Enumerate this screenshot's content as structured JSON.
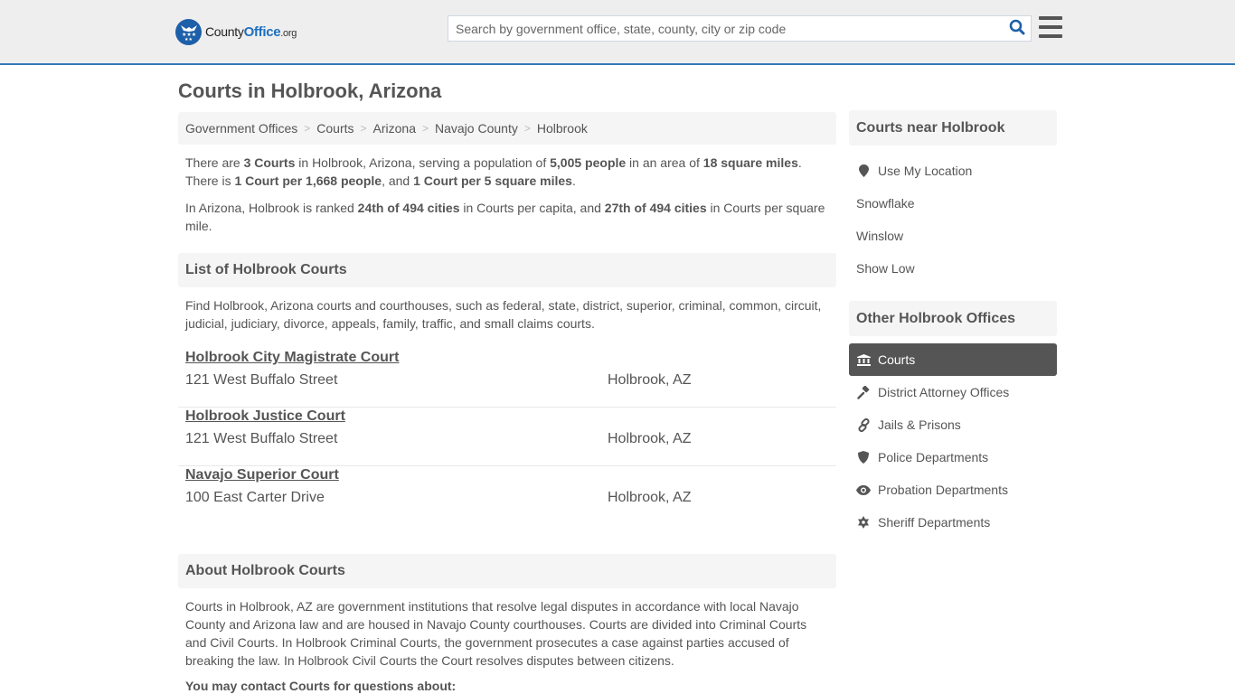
{
  "header": {
    "logo": {
      "brand_main": "County",
      "brand_accent": "Office",
      "brand_tld": ".org"
    },
    "search": {
      "placeholder": "Search by government office, state, county, city or zip code",
      "value": ""
    },
    "colors": {
      "accent": "#337ab7",
      "logo_blue": "#1d5fa8",
      "search_icon": "#1d5fa8"
    }
  },
  "page_title": "Courts in Holbrook, Arizona",
  "breadcrumb": [
    {
      "label": "Government Offices"
    },
    {
      "label": "Courts"
    },
    {
      "label": "Arizona"
    },
    {
      "label": "Navajo County"
    },
    {
      "label": "Holbrook"
    }
  ],
  "summary": {
    "line1_a": "There are ",
    "count": "3 Courts",
    "line1_b": " in Holbrook, Arizona, serving a population of ",
    "population": "5,005 people",
    "line1_c": " in an area of ",
    "area": "18 square miles",
    "line1_d": ".",
    "line2_a": "There is ",
    "per_capita": "1 Court per 1,668 people",
    "line2_b": ", and ",
    "per_area": "1 Court per 5 square miles",
    "line2_c": ".",
    "rank_a": "In Arizona, Holbrook is ranked ",
    "rank_capita": "24th of 494 cities",
    "rank_b": " in Courts per capita, and ",
    "rank_area": "27th of 494 cities",
    "rank_c": " in Courts per square mile."
  },
  "list_section": {
    "title": "List of Holbrook Courts",
    "description": "Find Holbrook, Arizona courts and courthouses, such as federal, state, district, superior, criminal, common, circuit, judicial, judiciary, divorce, appeals, family, traffic, and small claims courts.",
    "courts": [
      {
        "name": "Holbrook City Magistrate Court",
        "address": "121 West Buffalo Street",
        "city": "Holbrook, AZ"
      },
      {
        "name": "Holbrook Justice Court",
        "address": "121 West Buffalo Street",
        "city": "Holbrook, AZ"
      },
      {
        "name": "Navajo Superior Court",
        "address": "100 East Carter Drive",
        "city": "Holbrook, AZ"
      }
    ]
  },
  "about_section": {
    "title": "About Holbrook Courts",
    "body": "Courts in Holbrook, AZ are government institutions that resolve legal disputes in accordance with local Navajo County and Arizona law and are housed in Navajo County courthouses. Courts are divided into Criminal Courts and Civil Courts. In Holbrook Criminal Courts, the government prosecutes a case against parties accused of breaking the law. In Holbrook Civil Courts the Court resolves disputes between citizens.",
    "contact_heading": "You may contact Courts for questions about:"
  },
  "sidebar": {
    "near": {
      "title": "Courts near Holbrook",
      "use_location": {
        "label": "Use My Location",
        "icon": "map-marker-icon"
      },
      "cities": [
        {
          "label": "Snowflake"
        },
        {
          "label": "Winslow"
        },
        {
          "label": "Show Low"
        }
      ]
    },
    "offices": {
      "title": "Other Holbrook Offices",
      "items": [
        {
          "label": "Courts",
          "icon": "courthouse-icon",
          "active": true
        },
        {
          "label": "District Attorney Offices",
          "icon": "gavel-icon",
          "active": false
        },
        {
          "label": "Jails & Prisons",
          "icon": "link-chain-icon",
          "active": false
        },
        {
          "label": "Police Departments",
          "icon": "shield-icon",
          "active": false
        },
        {
          "label": "Probation Departments",
          "icon": "eye-icon",
          "active": false
        },
        {
          "label": "Sheriff Departments",
          "icon": "sheriff-star-icon",
          "active": false
        }
      ]
    }
  }
}
